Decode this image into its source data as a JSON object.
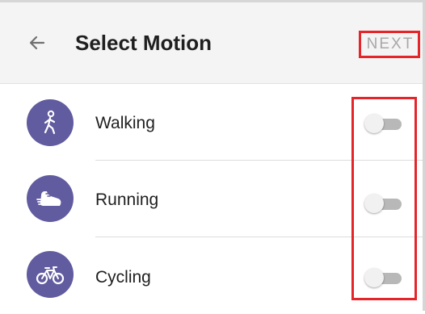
{
  "header": {
    "back_icon": "arrow-left-icon",
    "title": "Select Motion",
    "next_label": "NEXT",
    "next_state": "disabled"
  },
  "motions": [
    {
      "label": "Walking",
      "icon": "walking-icon",
      "enabled": false
    },
    {
      "label": "Running",
      "icon": "running-shoe-icon",
      "enabled": false
    },
    {
      "label": "Cycling",
      "icon": "bicycle-icon",
      "enabled": false
    }
  ],
  "colors": {
    "header_bg": "#f4f4f4",
    "avatar_bg": "#615b9f",
    "toggle_track": "#b8b8b8",
    "toggle_thumb": "#f1f1f1",
    "highlight": "#e5252a",
    "next_text": "#a8a8a8",
    "text": "#1f1f1f"
  }
}
